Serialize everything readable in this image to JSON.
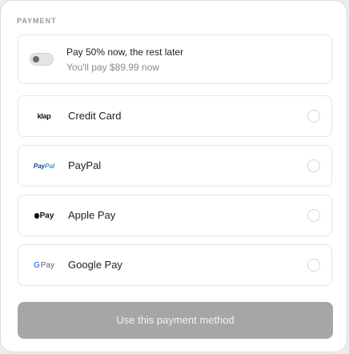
{
  "section": {
    "title": "PAYMENT"
  },
  "split_payment": {
    "title": "Pay 50% now, the rest later",
    "subtitle": "You'll pay $89.99 now",
    "enabled": false
  },
  "methods": [
    {
      "label": "Credit Card",
      "logo_text": "klap",
      "icon": "klap-logo",
      "selected": false
    },
    {
      "label": "PayPal",
      "logo_text_1": "Pay",
      "logo_text_2": "Pal",
      "icon": "paypal-logo",
      "selected": false
    },
    {
      "label": "Apple Pay",
      "logo_text": "Pay",
      "icon": "apple-pay-logo",
      "selected": false
    },
    {
      "label": "Google Pay",
      "logo_g": "G",
      "logo_text": "Pay",
      "icon": "google-pay-logo",
      "selected": false
    }
  ],
  "submit": {
    "label": "Use this payment method"
  },
  "colors": {
    "background": "#ededed",
    "card": "#ffffff",
    "button_disabled": "#a6a6a6",
    "paypal_dark": "#123a8c",
    "paypal_light": "#2a9bdb",
    "google_blue": "#4285f4"
  }
}
